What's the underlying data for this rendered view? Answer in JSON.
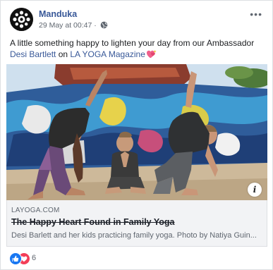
{
  "post": {
    "page_name": "Manduka",
    "timestamp": "29 May at 00:47",
    "separator": "·",
    "more_glyph": "•••",
    "text_before": "A little something happy to lighten your day from our Ambassador ",
    "mention_person": "Desi Bartlett",
    "text_middle": " on ",
    "mention_page": "LA YOGA Magazine",
    "text_emoji_name": "heart-emoji"
  },
  "preview": {
    "domain": "LAYOGA.COM",
    "headline": "The Happy Heart Found in Family Yoga",
    "description": "Desi Barlett and her kids practicing family yoga. Photo by Natiya Guin...",
    "info_glyph": "i"
  },
  "reactions": {
    "count": "6",
    "icons": [
      "like-icon",
      "love-icon"
    ]
  },
  "colors": {
    "link": "#385898",
    "meta": "#606770",
    "like": "#1877f2",
    "love": "#f33e58",
    "preview_bg": "#f2f3f5"
  }
}
